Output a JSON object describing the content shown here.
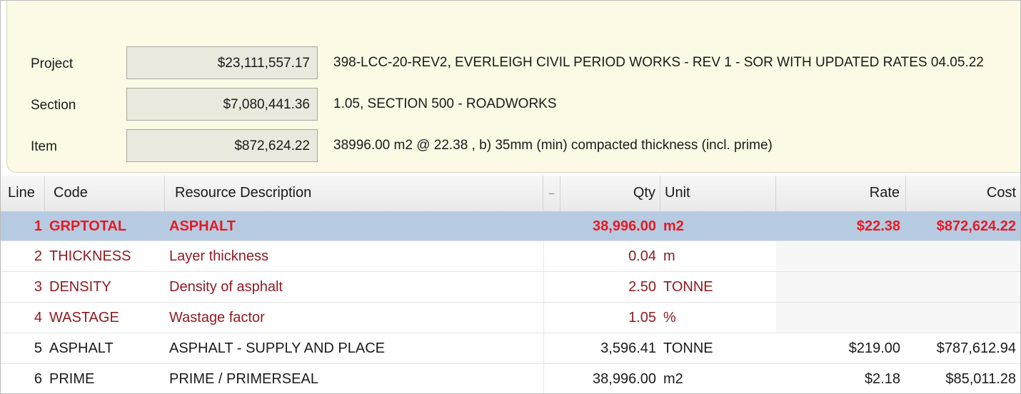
{
  "summary": {
    "project": {
      "label": "Project",
      "value": "$23,111,557.17",
      "desc": "398-LCC-20-REV2, EVERLEIGH CIVIL PERIOD WORKS - REV 1 - SOR WITH UPDATED RATES 04.05.22"
    },
    "section": {
      "label": "Section",
      "value": "$7,080,441.36",
      "desc": "1.05, SECTION 500 - ROADWORKS"
    },
    "item": {
      "label": "Item",
      "value": "$872,624.22",
      "desc": "38996.00 m2 @ 22.38 , b) 35mm (min) compacted thickness (incl. prime)"
    }
  },
  "columns": {
    "line": "Line",
    "code": "Code",
    "desc": "Resource Description",
    "marker": "̶",
    "qty": "Qty",
    "unit": "Unit",
    "rate": "Rate",
    "cost": "Cost"
  },
  "rows": [
    {
      "line": "1",
      "code": "GRPTOTAL",
      "desc": "ASPHALT",
      "qty": "38,996.00",
      "unit": "m2",
      "rate": "$22.38",
      "cost": "$872,624.22"
    },
    {
      "line": "2",
      "code": "THICKNESS",
      "desc": "Layer thickness",
      "qty": "0.04",
      "unit": "m",
      "rate": "",
      "cost": ""
    },
    {
      "line": "3",
      "code": "DENSITY",
      "desc": "Density of asphalt",
      "qty": "2.50",
      "unit": "TONNE",
      "rate": "",
      "cost": ""
    },
    {
      "line": "4",
      "code": "WASTAGE",
      "desc": "Wastage factor",
      "qty": "1.05",
      "unit": "%",
      "rate": "",
      "cost": ""
    },
    {
      "line": "5",
      "code": "ASPHALT",
      "desc": "ASPHALT - SUPPLY AND PLACE",
      "qty": "3,596.41",
      "unit": "TONNE",
      "rate": "$219.00",
      "cost": "$787,612.94"
    },
    {
      "line": "6",
      "code": "PRIME",
      "desc": "PRIME / PRIMERSEAL",
      "qty": "38,996.00",
      "unit": "m2",
      "rate": "$2.18",
      "cost": "$85,011.28"
    }
  ],
  "colors": {
    "selected_row": "#b6cbe2",
    "group_total_text": "#e41b23",
    "parameter_text": "#8e1a1f",
    "summary_bg": "#fcf9e4"
  }
}
